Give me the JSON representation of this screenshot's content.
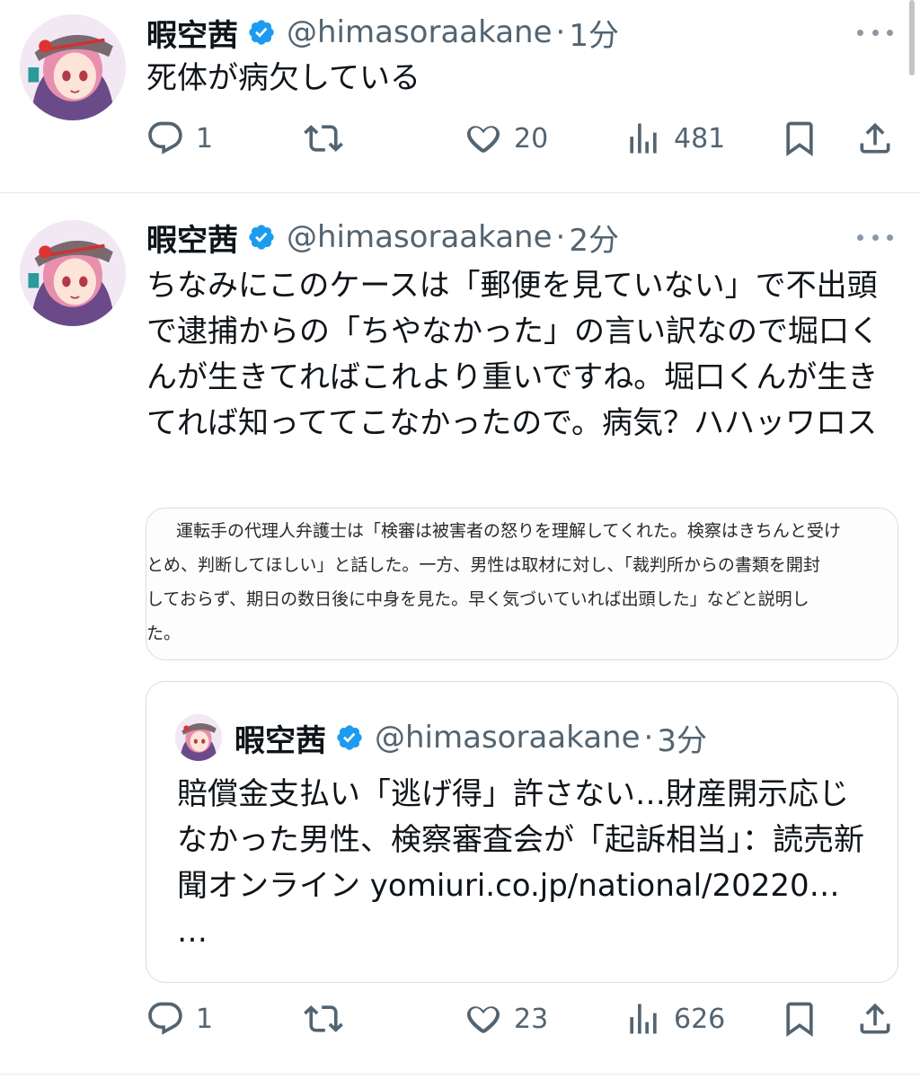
{
  "tweets": [
    {
      "name": "暇空茜",
      "handle": "@himasoraakane",
      "dot": "·",
      "time": "1分",
      "text": "死体が病欠している",
      "replies": "1",
      "likes": "20",
      "views": "481"
    },
    {
      "name": "暇空茜",
      "handle": "@himasoraakane",
      "dot": "·",
      "time": "2分",
      "text": "ちなみにこのケースは「郵便を見ていない」で不出頭で逮捕からの「ちやなかった」の言い訳なので堀口くんが生きてればこれより重いですね。堀口くんが生きてれば知っててこなかったので。病気？ハハッワロス",
      "image_lines": [
        "　運転手の代理人弁護士は「検審は被害者の怒りを理解してくれた。検察はきちんと受け",
        "とめ、判断してほしい」と話した。一方、男性は取材に対し、「裁判所からの書類を開封",
        "しておらず、期日の数日後に中身を見た。早く気づいていれば出頭した」などと説明し",
        "た。"
      ],
      "quote": {
        "name": "暇空茜",
        "handle": "@himasoraakane",
        "dot": "·",
        "time": "3分",
        "text": "賠償金支払い「逃げ得」許さない…財産開示応じなかった男性、検察審査会が「起訴相当」：読売新聞オンライン yomiuri.co.jp/national/20220… …"
      },
      "replies": "1",
      "likes": "23",
      "views": "626"
    }
  ],
  "icons": {
    "verified": "verified-badge-icon",
    "more": "more-icon",
    "reply": "reply-icon",
    "retweet": "retweet-icon",
    "like": "like-icon",
    "views": "views-icon",
    "bookmark": "bookmark-icon",
    "share": "share-icon"
  },
  "colors": {
    "verified": "#1d9bf0",
    "text": "#0f1419",
    "secondary": "#536471",
    "border": "#d9dcde"
  }
}
